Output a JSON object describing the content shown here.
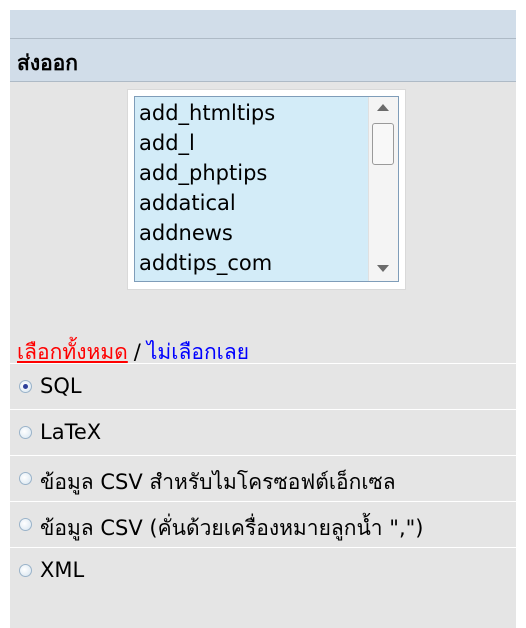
{
  "header": {
    "title": "ส่งออก"
  },
  "tables": {
    "items": [
      "add_htmltips",
      "add_l",
      "add_phptips",
      "addatical",
      "addnews",
      "addtips_com"
    ]
  },
  "selection_links": {
    "select_all": "เลือกทั้งหมด",
    "separator": "/",
    "select_none": "ไม่เลือกเลย"
  },
  "formats": {
    "selected": "SQL",
    "options": [
      "SQL",
      "LaTeX",
      "ข้อมูล CSV สำหรับไมโครซอฟต์เอ็กเซล",
      "ข้อมูล CSV (คั่นด้วยเครื่องหมายลูกน้ำ \",\")",
      "XML"
    ]
  },
  "colors": {
    "header_bg": "#d1dde9",
    "panel_bg": "#e5e5e5",
    "list_bg": "#d3ecf8",
    "select_all_link": "#ff0000",
    "select_none_link": "#0000ff"
  }
}
